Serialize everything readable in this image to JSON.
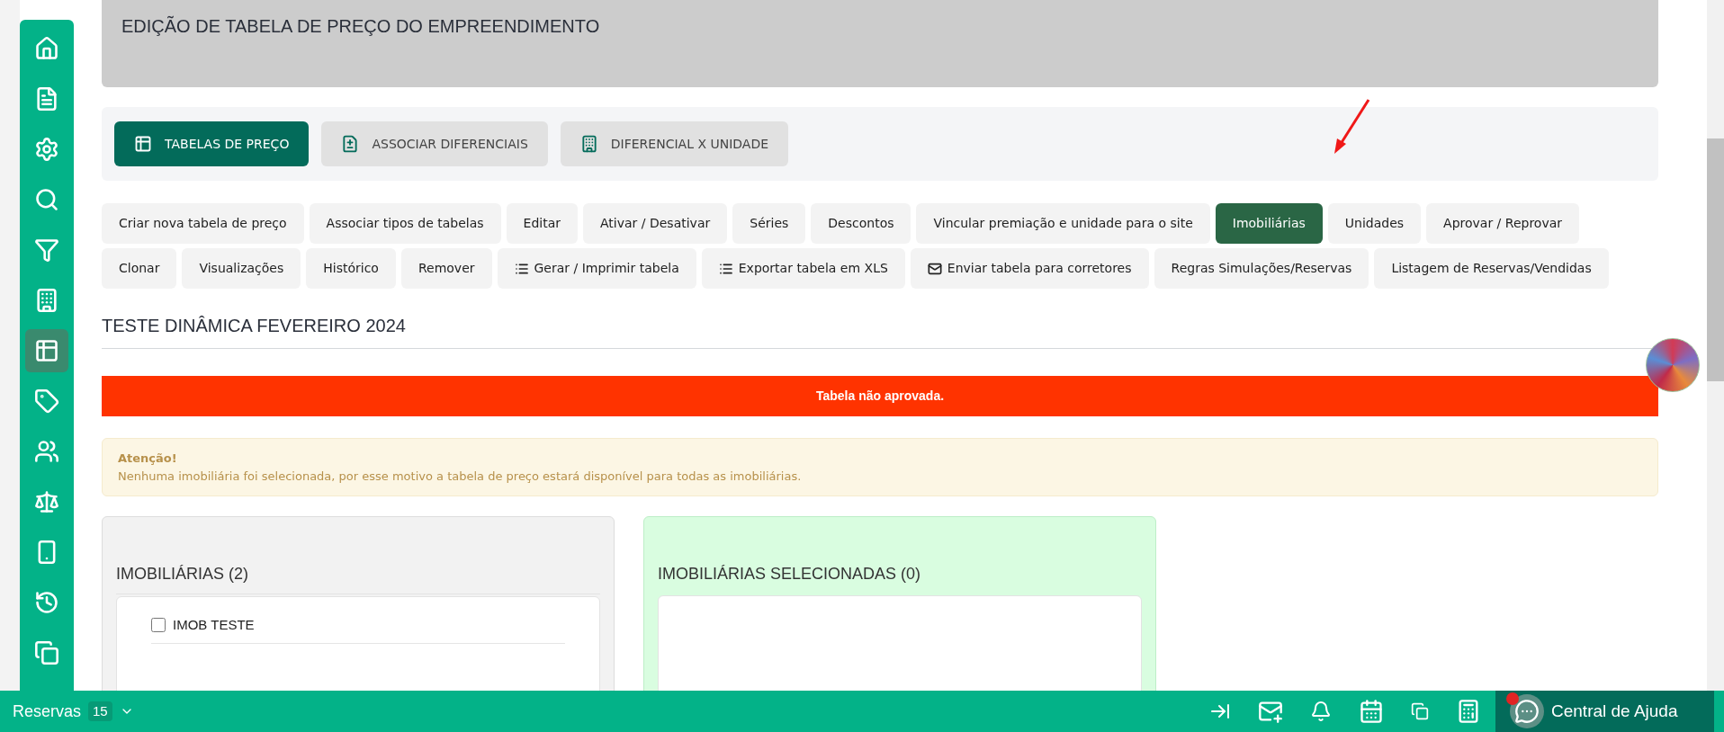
{
  "sidebar": {
    "items": [
      {
        "selected": false
      },
      {
        "selected": false
      },
      {
        "selected": false
      },
      {
        "selected": false
      },
      {
        "selected": false
      },
      {
        "selected": false
      },
      {
        "selected": true
      },
      {
        "selected": false
      },
      {
        "selected": false
      },
      {
        "selected": false
      },
      {
        "selected": false
      },
      {
        "selected": false
      },
      {
        "selected": false
      }
    ]
  },
  "header": {
    "title": "EDIÇÃO DE TABELA DE PREÇO DO EMPREENDIMENTO"
  },
  "tabs": [
    {
      "label": "TABELAS DE PREÇO",
      "selected": true
    },
    {
      "label": "ASSOCIAR DIFERENCIAIS",
      "selected": false
    },
    {
      "label": "DIFERENCIAL X UNIDADE",
      "selected": false
    }
  ],
  "actions": [
    {
      "label": "Criar nova tabela de preço",
      "selected": false,
      "kind": "plain"
    },
    {
      "label": "Associar tipos de tabelas",
      "selected": false,
      "kind": "plain"
    },
    {
      "label": "Editar",
      "selected": false,
      "kind": "plain"
    },
    {
      "label": "Ativar / Desativar",
      "selected": false,
      "kind": "plain"
    },
    {
      "label": "Séries",
      "selected": false,
      "kind": "plain"
    },
    {
      "label": "Descontos",
      "selected": false,
      "kind": "plain"
    },
    {
      "label": "Vincular premiação e unidade para o site",
      "selected": false,
      "kind": "plain"
    },
    {
      "label": "Imobiliárias",
      "selected": true,
      "kind": "plain"
    },
    {
      "label": "Unidades",
      "selected": false,
      "kind": "plain"
    },
    {
      "label": "Aprovar / Reprovar",
      "selected": false,
      "kind": "plain"
    },
    {
      "label": "Clonar",
      "selected": false,
      "kind": "plain"
    },
    {
      "label": "Visualizações",
      "selected": false,
      "kind": "plain"
    },
    {
      "label": "Histórico",
      "selected": false,
      "kind": "plain"
    },
    {
      "label": "Remover",
      "selected": false,
      "kind": "plain"
    },
    {
      "label": "Gerar / Imprimir tabela",
      "selected": false,
      "kind": "list"
    },
    {
      "label": "Exportar tabela em XLS",
      "selected": false,
      "kind": "list"
    },
    {
      "label": "Enviar tabela para corretores",
      "selected": false,
      "kind": "mail"
    },
    {
      "label": "Regras Simulações/Reservas",
      "selected": false,
      "kind": "plain"
    },
    {
      "label": "Listagem de Reservas/Vendidas",
      "selected": false,
      "kind": "plain"
    }
  ],
  "table_title": "TESTE DINÂMICA FEVEREIRO 2024",
  "status_banner": "Tabela não aprovada.",
  "alert": {
    "title": "Atenção!",
    "message": "Nenhuma imobiliária foi selecionada, por esse motivo a tabela de preço estará disponível para todas as imobiliárias."
  },
  "available_panel": {
    "title": "IMOBILIÁRIAS (2)",
    "items": [
      {
        "label": "IMOB TESTE",
        "checked": false
      }
    ]
  },
  "selected_panel": {
    "title": "IMOBILIÁRIAS SELECIONADAS (0)"
  },
  "bottom_bar": {
    "reservations_label": "Reservas",
    "reservations_count": "15",
    "help_label": "Central de Ajuda",
    "help_unread": true
  }
}
